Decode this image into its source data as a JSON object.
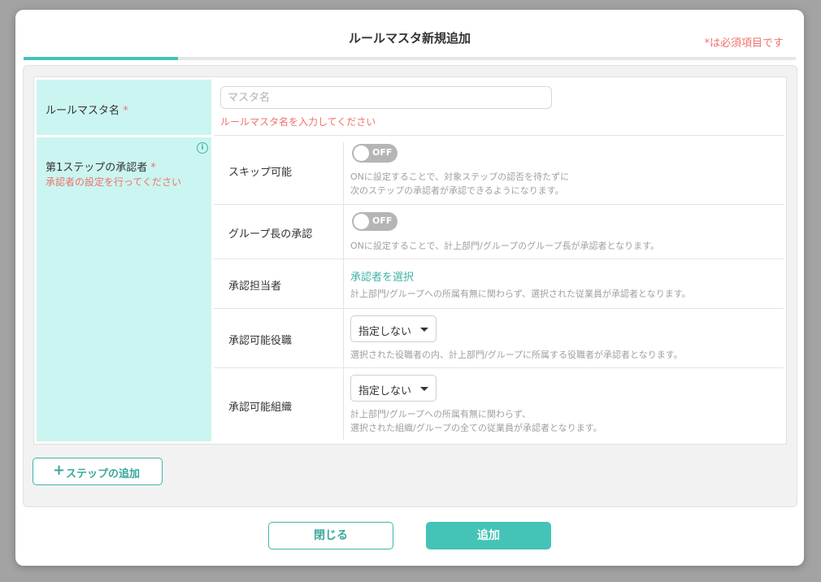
{
  "modal": {
    "title": "ルールマスタ新規追加",
    "required_note": "*は必須項目です"
  },
  "master_name": {
    "label": "ルールマスタ名",
    "required_mark": "*",
    "placeholder": "マスタ名",
    "value": "",
    "error": "ルールマスタ名を入力してください"
  },
  "step1": {
    "label": "第1ステップの承認者",
    "required_mark": "*",
    "error": "承認者の設定を行ってください",
    "info_icon": "i",
    "skip": {
      "label": "スキップ可能",
      "toggle": "OFF",
      "desc1": "ONに設定することで、対象ステップの認否を待たずに",
      "desc2": "次のステップの承認者が承認できるようになります。"
    },
    "group_leader": {
      "label": "グループ長の承認",
      "toggle": "OFF",
      "desc1": "ONに設定することで、計上部門/グループのグループ長が承認者となります。"
    },
    "assignee": {
      "label": "承認担当者",
      "link": "承認者を選択",
      "desc1": "計上部門/グループへの所属有無に関わらず、選択された従業員が承認者となります。"
    },
    "position": {
      "label": "承認可能役職",
      "select": "指定しない",
      "desc1": "選択された役職者の内、計上部門/グループに所属する役職者が承認者となります。"
    },
    "org": {
      "label": "承認可能組織",
      "select": "指定しない",
      "desc1": "計上部門/グループへの所属有無に関わらず、",
      "desc2": "選択された組織/グループの全ての従業員が承認者となります。"
    }
  },
  "buttons": {
    "add_step_plus": "+",
    "add_step": "ステップの追加",
    "close": "閉じる",
    "add": "追加"
  },
  "colors": {
    "accent": "#43c4b6",
    "error": "#f0716d",
    "label_bg": "#cbf5f0"
  }
}
